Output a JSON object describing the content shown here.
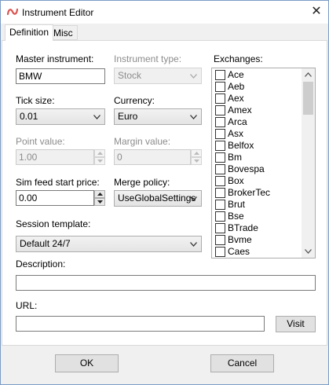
{
  "window": {
    "title": "Instrument Editor",
    "close_glyph": "✕"
  },
  "tabs": [
    {
      "label": "Definition",
      "active": true
    },
    {
      "label": "Misc",
      "active": false
    }
  ],
  "fields": {
    "master_instrument": {
      "label": "Master instrument:",
      "value": "BMW"
    },
    "instrument_type": {
      "label": "Instrument type:",
      "value": "Stock"
    },
    "tick_size": {
      "label": "Tick size:",
      "value": "0.01"
    },
    "currency": {
      "label": "Currency:",
      "value": "Euro"
    },
    "point_value": {
      "label": "Point value:",
      "value": "1.00"
    },
    "margin_value": {
      "label": "Margin value:",
      "value": "0"
    },
    "sim_feed_start_price": {
      "label": "Sim feed start price:",
      "value": "0.00"
    },
    "merge_policy": {
      "label": "Merge policy:",
      "value": "UseGlobalSettings"
    },
    "session_template": {
      "label": "Session template:",
      "value": "Default 24/7"
    },
    "description": {
      "label": "Description:",
      "value": ""
    },
    "url": {
      "label": "URL:",
      "value": ""
    }
  },
  "exchanges": {
    "label": "Exchanges:",
    "items": [
      "Ace",
      "Aeb",
      "Aex",
      "Amex",
      "Arca",
      "Asx",
      "Belfox",
      "Bm",
      "Bovespa",
      "Box",
      "BrokerTec",
      "Brut",
      "Bse",
      "BTrade",
      "Bvme",
      "Caes"
    ]
  },
  "buttons": {
    "visit": "Visit",
    "ok": "OK",
    "cancel": "Cancel"
  },
  "colors": {
    "accent": "#7a9cc6",
    "app_icon": "#d9534f"
  }
}
